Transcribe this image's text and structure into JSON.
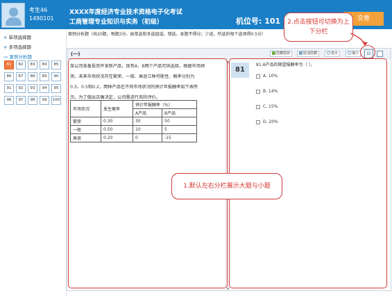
{
  "header": {
    "candidate_name": "考生46",
    "candidate_id": "1490101",
    "exam_title": "XXXX年度经济专业技术资格电子化考试",
    "subject": "工商管理专业知识与实务（初级）",
    "seat_label": "机位号: 101",
    "submit_label": "交卷"
  },
  "sidebar": {
    "sections": [
      {
        "icon": "+",
        "label": "单项选择题"
      },
      {
        "icon": "+",
        "label": "多项选择题"
      },
      {
        "icon": "—",
        "label": "案例分析题"
      }
    ],
    "numbers": [
      "81",
      "82",
      "83",
      "84",
      "85",
      "86",
      "87",
      "88",
      "89",
      "90",
      "91",
      "92",
      "93",
      "94",
      "95",
      "96",
      "97",
      "98",
      "99",
      "100"
    ],
    "active_number": "81"
  },
  "info_line": "案例分析题（共20题，每题2分。由单选和多选组成。错选，本题不得分；少选，所选的每个选项得0.5分）",
  "toolbar": {
    "section": "(一)",
    "buttons": [
      "隐藏题目",
      "取消隐藏",
      "放大",
      "缩小"
    ]
  },
  "case": {
    "paragraphs": [
      "某公司准备投资开发新产品，现有A、B两个产品可供选择。根据市场预",
      "测，未来市场状况存在繁荣、一般、衰退三种可能性，概率分别为",
      "0.3、0.5和0.2，两种产品在不同市场状况的预计年报酬率如下表所",
      "示。为了做出正确决定，公司需进行风险评价。"
    ],
    "table": {
      "headers": [
        "市场状况",
        "发生概率",
        "预计年报酬率（%）",
        "A产品",
        "B产品"
      ],
      "rows": [
        [
          "繁荣",
          "0.30",
          "30",
          "50"
        ],
        [
          "一般",
          "0.50",
          "10",
          "5"
        ],
        [
          "衰退",
          "0.20",
          "0",
          "-15"
        ]
      ]
    }
  },
  "question": {
    "number": "81",
    "text": "81.A产品的期望报酬率为（        ）。",
    "options": [
      "A. 10%",
      "B. 14%",
      "C. 15%",
      "D. 20%"
    ]
  },
  "annotations": {
    "top": "2.点击按钮可切换为上下分栏",
    "middle": "1.默认左右分栏展示大题与小题"
  },
  "colors": {
    "header_blue": "#1a7fc7",
    "submit_orange": "#f3a13a",
    "active_number": "#f1793d",
    "annotation_red": "#d13a3a"
  }
}
